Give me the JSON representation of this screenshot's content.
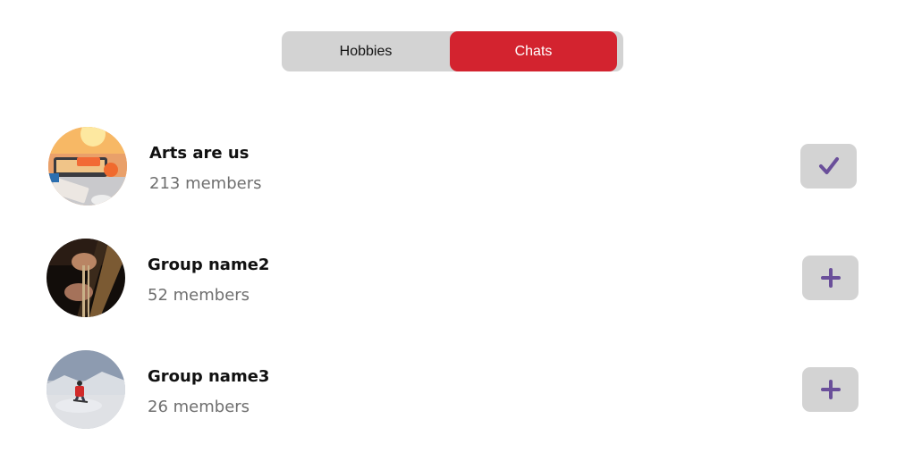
{
  "tabs": {
    "hobbies_label": "Hobbies",
    "chats_label": "Chats",
    "active": "Chats"
  },
  "groups": [
    {
      "name": "Arts are us",
      "members": "213 members",
      "joined": true,
      "action_icon": "check-icon",
      "avatar": "desk-workspace-photo"
    },
    {
      "name": "Group name2",
      "members": "52 members",
      "joined": false,
      "action_icon": "plus-icon",
      "avatar": "guitar-photo"
    },
    {
      "name": "Group name3",
      "members": "26 members",
      "joined": false,
      "action_icon": "plus-icon",
      "avatar": "skier-photo"
    }
  ],
  "colors": {
    "accent": "#d3232f",
    "segment_bg": "#d3d3d3",
    "icon": "#6a4f9a",
    "muted_text": "#6f6f6f"
  }
}
